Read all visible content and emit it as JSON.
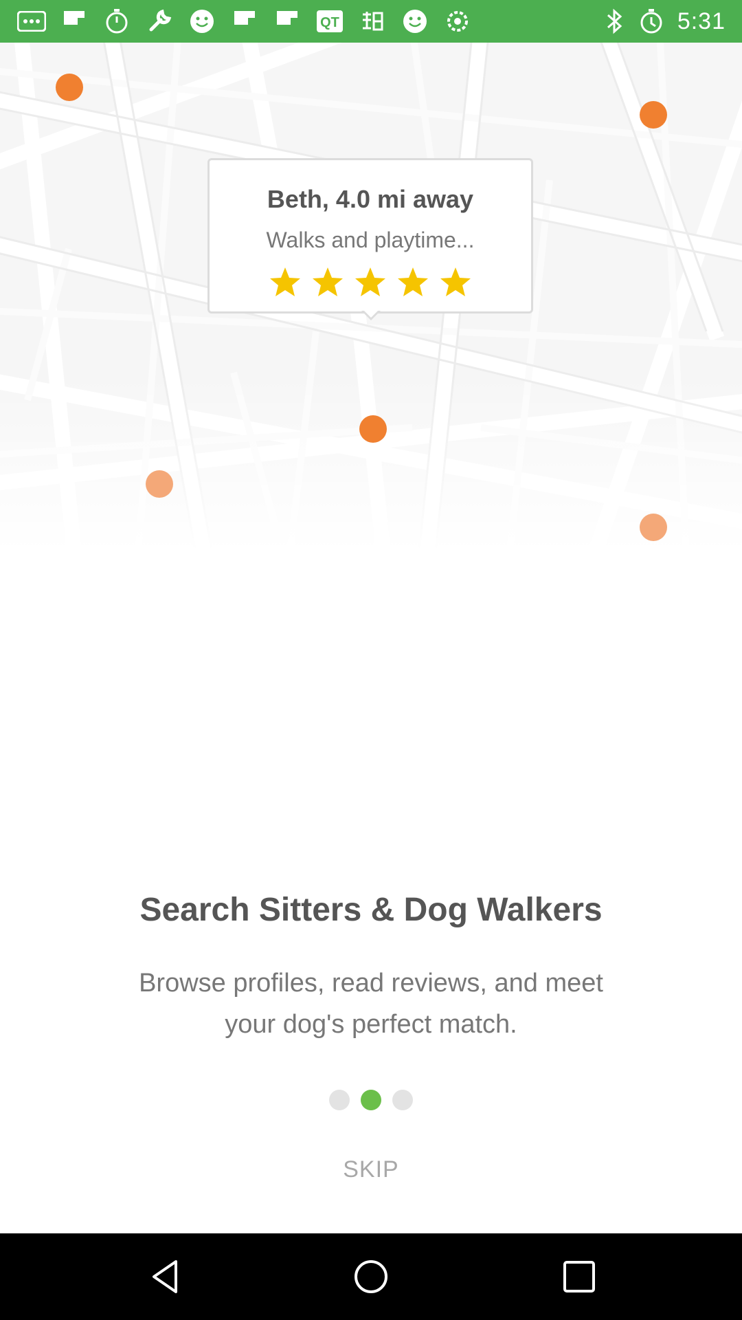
{
  "status_bar": {
    "time": "5:31",
    "left_icons": [
      "more-icon",
      "flipboard-icon",
      "timer-icon",
      "wrench-icon",
      "smiley-icon",
      "flipboard-icon",
      "flipboard-icon",
      "qt-icon",
      "chinese-char-icon",
      "smiley-icon",
      "settings-icon"
    ],
    "right_icons": [
      "bluetooth-icon",
      "alarm-icon"
    ]
  },
  "card": {
    "name": "Beth, 4.0 mi away",
    "subtitle": "Walks and playtime...",
    "rating": 5,
    "rating_max": 5,
    "star_color": "#f5c400"
  },
  "onboarding": {
    "title": "Search Sitters & Dog Walkers",
    "description": "Browse profiles, read reviews, and meet your dog's perfect match.",
    "page_index": 1,
    "page_count": 3,
    "skip_label": "SKIP"
  },
  "colors": {
    "status_bar": "#4caf50",
    "pin": "#f08030",
    "active_dot": "#6bbf4a"
  }
}
